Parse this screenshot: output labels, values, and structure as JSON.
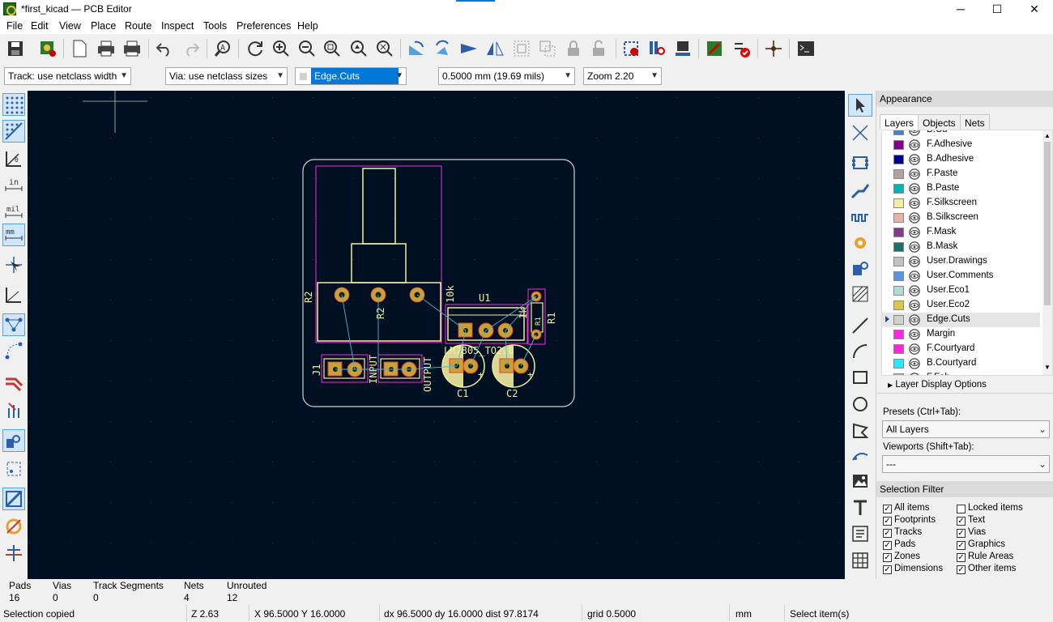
{
  "window": {
    "title": "*first_kicad — PCB Editor",
    "controls": {
      "minimize": "─",
      "maximize": "☐",
      "close": "✕"
    }
  },
  "menu": [
    "File",
    "Edit",
    "View",
    "Place",
    "Route",
    "Inspect",
    "Tools",
    "Preferences",
    "Help"
  ],
  "toolbar2": {
    "track": "Track: use netclass width",
    "via": "Via: use netclass sizes",
    "layer": "Edge.Cuts",
    "grid": "0.5000 mm (19.69 mils)",
    "zoom": "Zoom 2.20"
  },
  "left_toolbar": {
    "units_in": "in",
    "units_mil": "mil",
    "units_mm": "mm"
  },
  "board": {
    "refs": {
      "r2_side": "R2",
      "r2_body": "R2",
      "r2_value": "10k",
      "u1": "U1",
      "u1_value": "LM7805_TO220",
      "r1_body": "R1",
      "r1_side": "R1",
      "r1_value": "1k",
      "j1": "J1",
      "j1_value": "INPUT",
      "j2_value": "OUTPUT",
      "c1": "C1",
      "c2": "C2",
      "plus": "+"
    }
  },
  "appearance": {
    "header": "Appearance",
    "tabs": [
      "Layers",
      "Objects",
      "Nets"
    ],
    "layers": [
      {
        "name": "B.Cu",
        "color": "#4d7fc4"
      },
      {
        "name": "F.Adhesive",
        "color": "#84008a"
      },
      {
        "name": "B.Adhesive",
        "color": "#00008a"
      },
      {
        "name": "F.Paste",
        "color": "#b4a09f"
      },
      {
        "name": "B.Paste",
        "color": "#00b4b4"
      },
      {
        "name": "F.Silkscreen",
        "color": "#f2eda1"
      },
      {
        "name": "B.Silkscreen",
        "color": "#e8b2a7"
      },
      {
        "name": "F.Mask",
        "color": "#833a8a"
      },
      {
        "name": "B.Mask",
        "color": "#1c6f6a"
      },
      {
        "name": "User.Drawings",
        "color": "#c2c2c2"
      },
      {
        "name": "User.Comments",
        "color": "#5994dc"
      },
      {
        "name": "User.Eco1",
        "color": "#b4dbd2"
      },
      {
        "name": "User.Eco2",
        "color": "#d8c852"
      },
      {
        "name": "Edge.Cuts",
        "color": "#d0d2cd"
      },
      {
        "name": "Margin",
        "color": "#ff26e2"
      },
      {
        "name": "F.Courtyard",
        "color": "#ff26e2"
      },
      {
        "name": "B.Courtyard",
        "color": "#26e9ff"
      },
      {
        "name": "F.Fab",
        "color": "#afafaf"
      }
    ],
    "layer_display_options": "Layer Display Options",
    "presets_label": "Presets (Ctrl+Tab):",
    "presets_value": "All Layers",
    "viewports_label": "Viewports (Shift+Tab):",
    "viewports_value": "---"
  },
  "selection_filter": {
    "header": "Selection Filter",
    "left": [
      {
        "label": "All items",
        "checked": true
      },
      {
        "label": "Footprints",
        "checked": true
      },
      {
        "label": "Tracks",
        "checked": true
      },
      {
        "label": "Pads",
        "checked": true
      },
      {
        "label": "Zones",
        "checked": true
      },
      {
        "label": "Dimensions",
        "checked": true
      }
    ],
    "right": [
      {
        "label": "Locked items",
        "checked": false
      },
      {
        "label": "Text",
        "checked": true
      },
      {
        "label": "Vias",
        "checked": true
      },
      {
        "label": "Graphics",
        "checked": true
      },
      {
        "label": "Rule Areas",
        "checked": true
      },
      {
        "label": "Other items",
        "checked": true
      }
    ]
  },
  "status": {
    "pads_label": "Pads",
    "pads_value": "16",
    "vias_label": "Vias",
    "vias_value": "0",
    "tracks_label": "Track Segments",
    "tracks_value": "0",
    "nets_label": "Nets",
    "nets_value": "4",
    "unrouted_label": "Unrouted",
    "unrouted_value": "12",
    "message": "Selection copied",
    "zoom": "Z 2.63",
    "coords": "X 96.5000  Y 16.0000",
    "delta": "dx 96.5000  dy 16.0000  dist 97.8174",
    "grid": "grid 0.5000",
    "units": "mm",
    "tool": "Select item(s)"
  }
}
